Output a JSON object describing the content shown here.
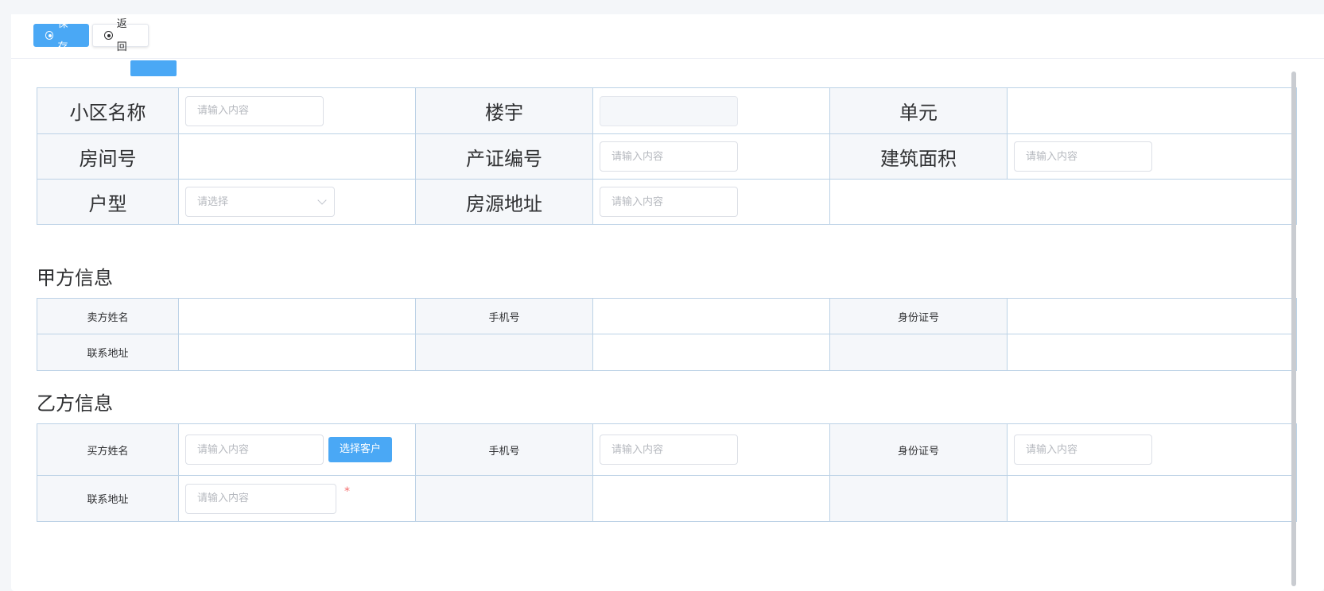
{
  "toolbar": {
    "save_label": "保存",
    "back_label": "返回"
  },
  "house_section": {
    "labels": {
      "community": "小区名称",
      "building": "楼宇",
      "unit": "单元",
      "room": "房间号",
      "cert_no": "产证编号",
      "area": "建筑面积",
      "layout": "户型",
      "address": "房源地址"
    },
    "placeholders": {
      "community": "请输入内容",
      "cert_no": "请输入内容",
      "area": "请输入内容",
      "layout": "请选择",
      "address": "请输入内容"
    }
  },
  "party_a": {
    "title": "甲方信息",
    "labels": {
      "seller_name": "卖方姓名",
      "phone": "手机号",
      "id_no": "身份证号",
      "contact_address": "联系地址"
    }
  },
  "party_b": {
    "title": "乙方信息",
    "labels": {
      "buyer_name": "买方姓名",
      "phone": "手机号",
      "id_no": "身份证号",
      "contact_address": "联系地址"
    },
    "placeholders": {
      "buyer_name": "请输入内容",
      "phone": "请输入内容",
      "id_no": "请输入内容",
      "contact_address": "请输入内容"
    },
    "choose_customer_label": "选择客户",
    "required_mark": "*"
  },
  "colors": {
    "primary": "#4aa8f5",
    "border": "#bcd2e6",
    "label_bg": "#f5f7fa"
  }
}
